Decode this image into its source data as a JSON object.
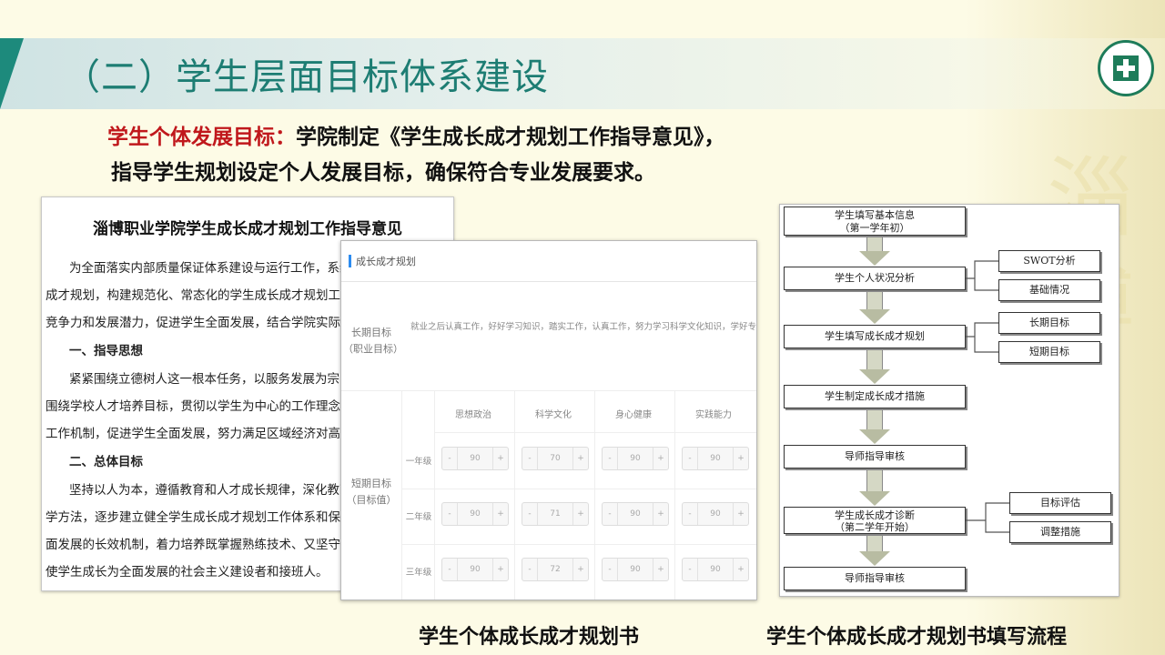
{
  "slide": {
    "title": "（二）学生层面目标体系建设",
    "headline_highlight": "学生个体发展目标：",
    "headline_rest": "学院制定《学生成长成才规划工作指导意见》，",
    "headline_line2": "指导学生规划设定个人发展目标，确保符合专业发展要求。",
    "caption_left": "学生个体成长成才规划书",
    "caption_right": "学生个体成长成才规划书填写流程"
  },
  "document": {
    "title": "淄博职业学院学生成长成才规划工作指导意见",
    "lines": [
      "为全面落实内部质量保证体系建设与运行工作，系统推",
      "成才规划，构建规范化、常态化的学生成长成才规划工作体",
      "竞争力和发展潜力，促进学生全面发展，结合学院实际，制",
      "一、指导思想",
      "紧紧围绕立德树人这一根本任务，以服务发展为宗旨，",
      "围绕学校人才培养目标，贯彻以学生为中心的工作理念，构",
      "工作机制，促进学生全面发展，努力满足区域经济对高职人",
      "二、总体目标",
      "坚持以人为本，遵循教育和人才成长规律，深化教育教",
      "学方法，逐步建立健全学生成长成才规划工作体系和保障措",
      "面发展的长效机制，着力培养既掌握熟练技术、又坚守职业",
      "使学生成长为全面发展的社会主义建设者和接班人。"
    ]
  },
  "form": {
    "header": "成长成才规划",
    "long_term_label": "长期目标（职业目标）",
    "long_term_text": "就业之后认真工作，好好学习知识，踏实工作，认真工作，努力学习科学文化知识，学好专业知识，为以后工作奠定基础。",
    "short_term_label": "短期目标（目标值）",
    "columns": [
      "思想政治",
      "科学文化",
      "身心健康",
      "实践能力"
    ],
    "rows": [
      {
        "grade": "一年级",
        "values": [
          "90",
          "70",
          "90",
          "90"
        ]
      },
      {
        "grade": "二年级",
        "values": [
          "90",
          "71",
          "90",
          "90"
        ]
      },
      {
        "grade": "三年级",
        "values": [
          "90",
          "72",
          "90",
          "90"
        ]
      }
    ],
    "minus": "-",
    "plus": "+"
  },
  "flowchart": {
    "step1_line1": "学生填写基本信息",
    "step1_line2": "（第一学年初）",
    "step2": "学生个人状况分析",
    "swot": "SWOT分析",
    "basic": "基础情况",
    "step3": "学生填写成长成才规划",
    "long_goal": "长期目标",
    "short_goal": "短期目标",
    "step4": "学生制定成长成才措施",
    "step5": "导师指导审核",
    "step6_line1": "学生成长成才诊断",
    "step6_line2": "（第二学年开始）",
    "eval": "目标评估",
    "adjust": "调整措施",
    "step7": "导师指导审核"
  }
}
